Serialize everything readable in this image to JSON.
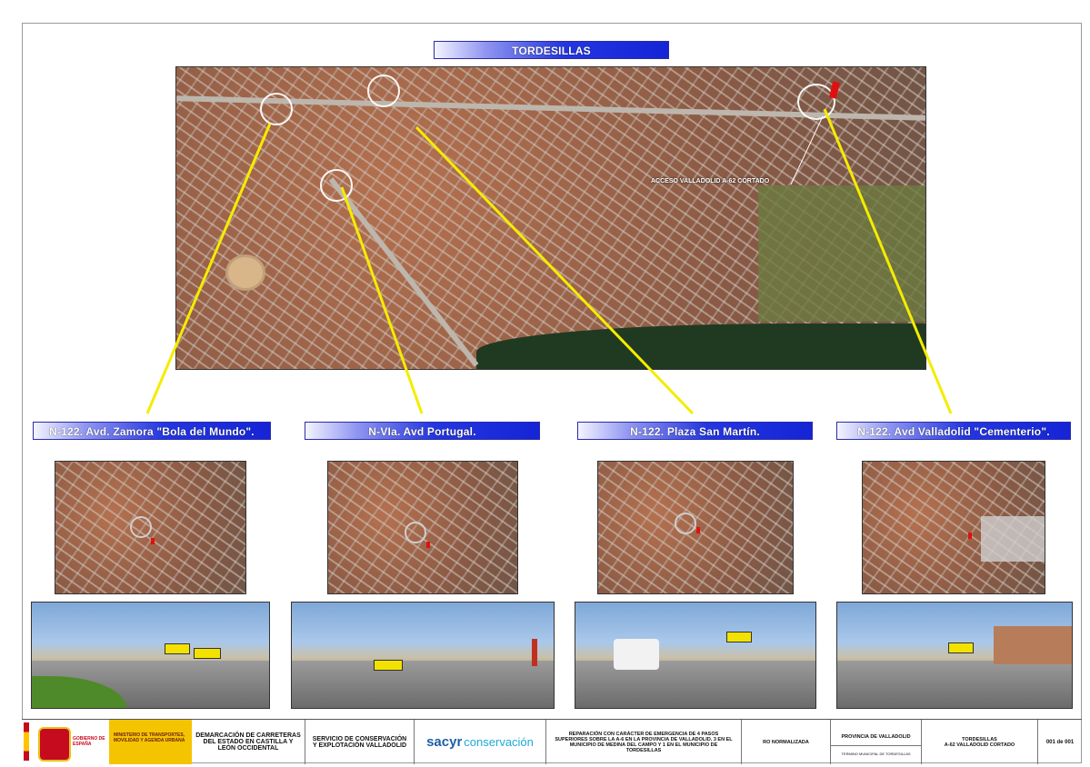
{
  "main_title": "TORDESILLAS",
  "aerial_annotation": "ACCESO VALLADOLID A-62 CORTADO",
  "locations": [
    {
      "title": "N-122. Avd. Zamora \"Bola del Mundo\"."
    },
    {
      "title": "N-VIa. Avd Portugal."
    },
    {
      "title": "N-122. Plaza San Martín."
    },
    {
      "title": "N-122. Avd Valladolid \"Cementerio\"."
    }
  ],
  "footer": {
    "gov_left": "GOBIERNO DE ESPAÑA",
    "gov_right": "MINISTERIO DE TRANSPORTES, MOVILIDAD Y AGENDA URBANA",
    "demarcacion": "DEMARCACIÓN DE CARRETERAS DEL ESTADO EN CASTILLA Y LEÓN OCCIDENTAL",
    "servicio": "SERVICIO DE CONSERVACIÓN Y EXPLOTACIÓN VALLADOLID",
    "logo_a": "sacyr",
    "logo_b": "conservación",
    "descripcion": "REPARACIÓN CON CARÁCTER DE EMERGENCIA DE 4 PASOS SUPERIORES SOBRE LA A-6 EN LA PROVINCIA DE VALLADOLID. 3 EN EL MUNICIPIO DE MEDINA DEL CAMPO Y 1 EN EL MUNICIPIO DE TORDESILLAS",
    "escala": "RO NORMALIZADA",
    "provincia": "PROVINCIA DE VALLADOLID",
    "termino": "TERMINO MUNICIPAL DE TORDESILLAS",
    "plano_title": "TORDESILLAS",
    "plano_subtitle": "A-62 VALLADOLID CORTADO",
    "plano_number": "001 de 001"
  },
  "colors": {
    "banner_blue": "#1524d6",
    "leader_yellow": "#f5ec00",
    "marker_red": "#e01010"
  }
}
